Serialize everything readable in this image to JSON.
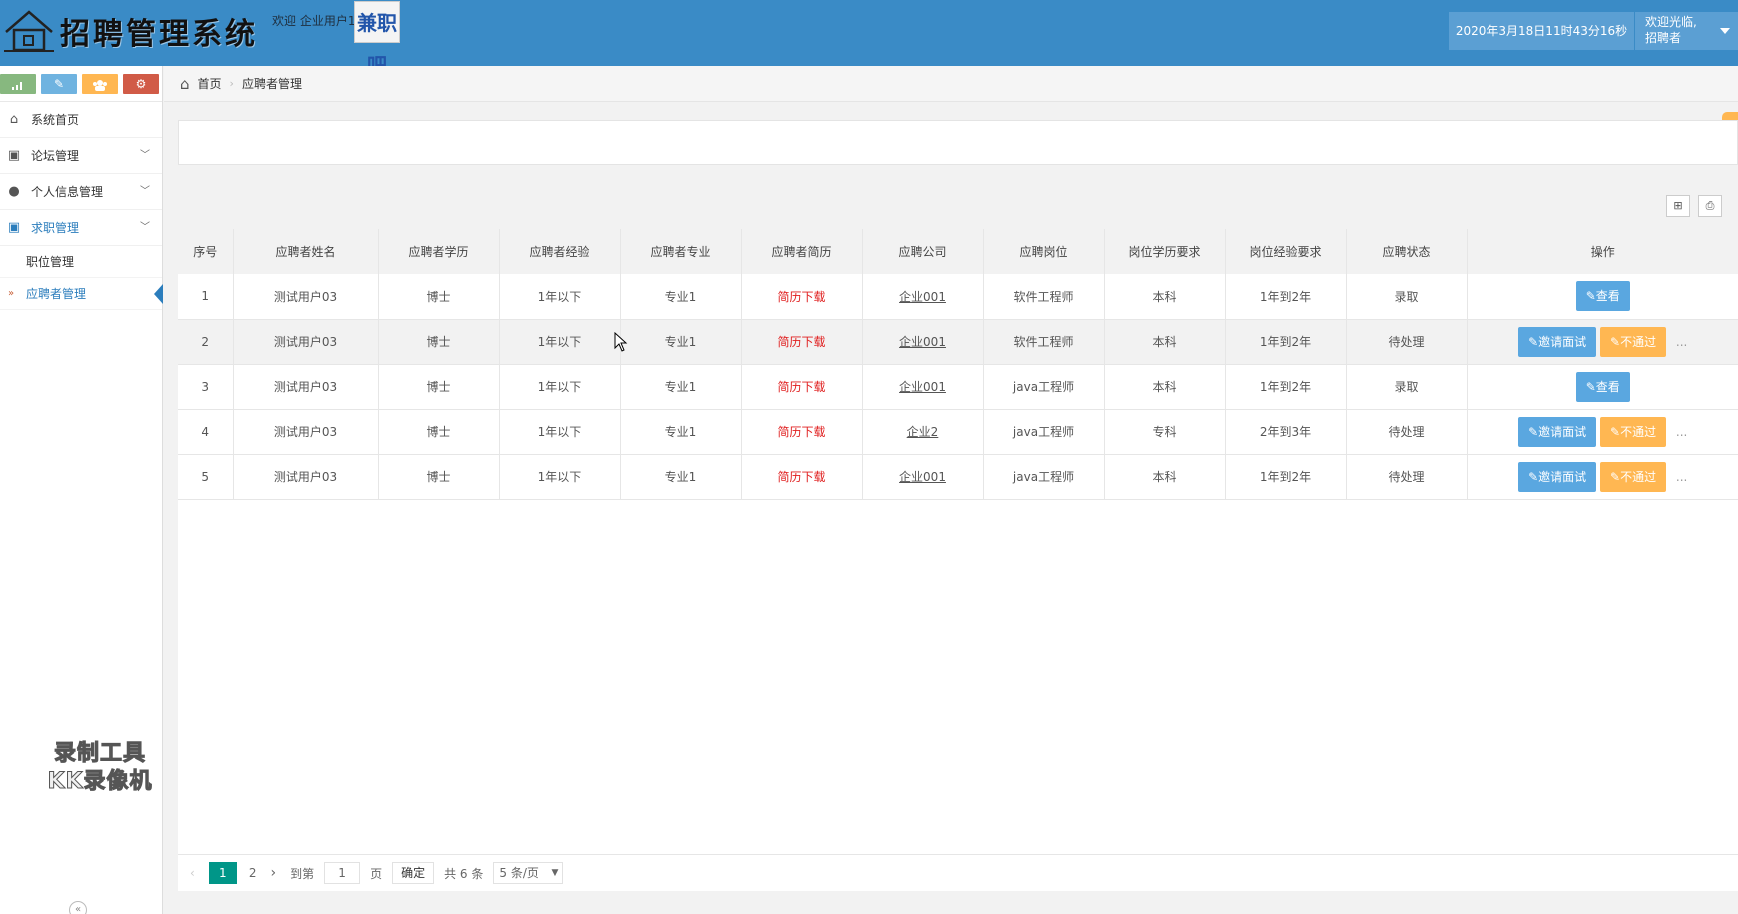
{
  "header": {
    "title": "招聘管理系统",
    "welcome_user": "欢迎 企业用户1",
    "brand_badge": "兼职吧",
    "datetime": "2020年3月18日11时43分16秒",
    "user_greeting_line1": "欢迎光临,",
    "user_greeting_line2": "招聘者",
    "header_color": "#3a8bc6"
  },
  "sidebar": {
    "quick_buttons": [
      {
        "icon": "signal-icon",
        "color": "#87b87f"
      },
      {
        "icon": "pencil-icon",
        "color": "#6fb3e0"
      },
      {
        "icon": "users-icon",
        "color": "#ffb752"
      },
      {
        "icon": "cogs-icon",
        "color": "#d15b47"
      }
    ],
    "items": [
      {
        "label": "系统首页",
        "icon": "home-icon"
      },
      {
        "label": "论坛管理",
        "icon": "picture-icon"
      },
      {
        "label": "个人信息管理",
        "icon": "user-icon"
      },
      {
        "label": "求职管理",
        "icon": "picture-icon"
      }
    ],
    "sub_items": [
      {
        "label": "职位管理"
      },
      {
        "label": "应聘者管理"
      }
    ],
    "watermark_line1": "录制工具",
    "watermark_line2": "KK录像机"
  },
  "breadcrumb": {
    "home": "首页",
    "current": "应聘者管理"
  },
  "table": {
    "columns": [
      "序号",
      "应聘者姓名",
      "应聘者学历",
      "应聘者经验",
      "应聘者专业",
      "应聘者简历",
      "应聘公司",
      "应聘岗位",
      "岗位学历要求",
      "岗位经验要求",
      "应聘状态",
      "操作"
    ],
    "rows": [
      {
        "no": "1",
        "name": "测试用户03",
        "edu": "博士",
        "exp": "1年以下",
        "major": "专业1",
        "resume": "简历下载",
        "company": "企业001",
        "job": "软件工程师",
        "job_edu": "本科",
        "job_exp": "1年到2年",
        "status": "录取"
      },
      {
        "no": "2",
        "name": "测试用户03",
        "edu": "博士",
        "exp": "1年以下",
        "major": "专业1",
        "resume": "简历下载",
        "company": "企业001",
        "job": "软件工程师",
        "job_edu": "本科",
        "job_exp": "1年到2年",
        "status": "待处理"
      },
      {
        "no": "3",
        "name": "测试用户03",
        "edu": "博士",
        "exp": "1年以下",
        "major": "专业1",
        "resume": "简历下载",
        "company": "企业001",
        "job": "java工程师",
        "job_edu": "本科",
        "job_exp": "1年到2年",
        "status": "录取"
      },
      {
        "no": "4",
        "name": "测试用户03",
        "edu": "博士",
        "exp": "1年以下",
        "major": "专业1",
        "resume": "简历下载",
        "company": "企业2",
        "job": "java工程师",
        "job_edu": "专科",
        "job_exp": "2年到3年",
        "status": "待处理"
      },
      {
        "no": "5",
        "name": "测试用户03",
        "edu": "博士",
        "exp": "1年以下",
        "major": "专业1",
        "resume": "简历下载",
        "company": "企业001",
        "job": "java工程师",
        "job_edu": "本科",
        "job_exp": "1年到2年",
        "status": "待处理"
      }
    ],
    "actions": {
      "view": "查看",
      "invite": "邀请面试",
      "reject": "不通过",
      "more": "..."
    }
  },
  "pagination": {
    "current_page": "1",
    "page_2": "2",
    "goto_label": "到第",
    "goto_value": "1",
    "page_unit": "页",
    "confirm": "确定",
    "total": "共 6 条",
    "page_size": "5 条/页",
    "active_color": "#009688"
  }
}
